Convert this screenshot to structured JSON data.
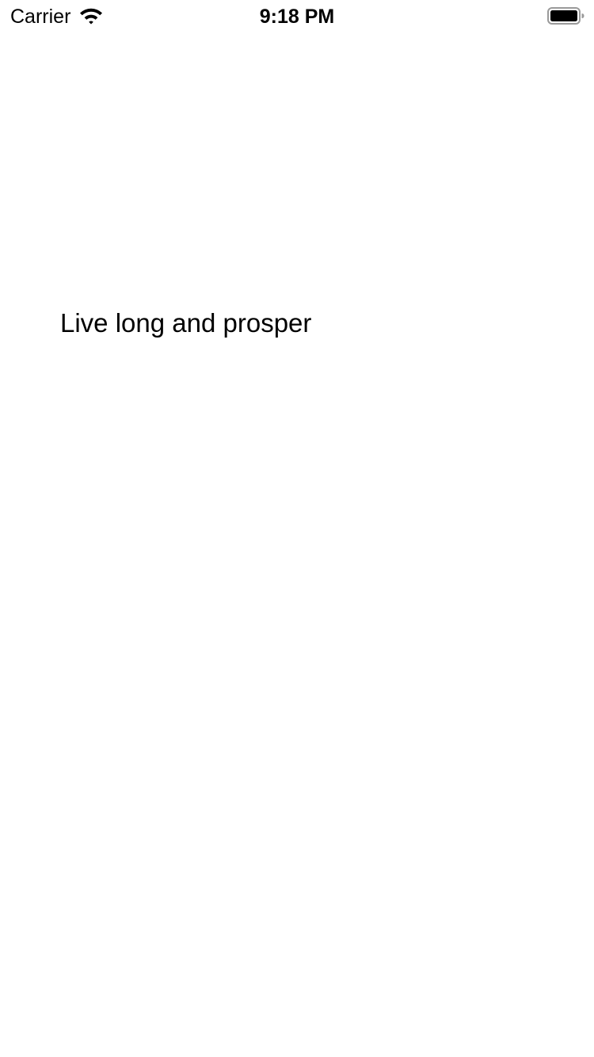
{
  "status_bar": {
    "carrier": "Carrier",
    "time": "9:18 PM",
    "wifi_icon": "wifi-icon",
    "battery_icon": "battery-icon"
  },
  "main": {
    "label": "Live long and prosper"
  },
  "colors": {
    "background": "#ffffff",
    "text": "#000000"
  }
}
